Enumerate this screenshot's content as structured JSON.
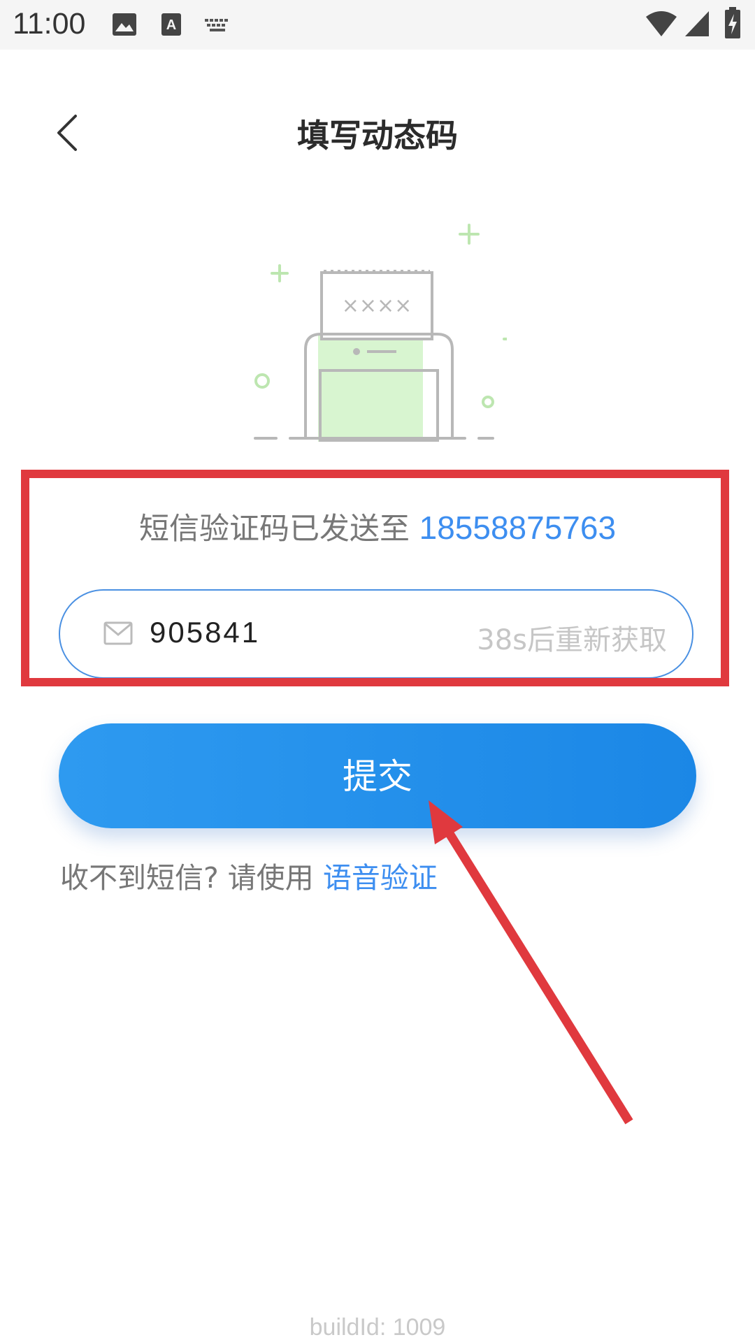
{
  "status_bar": {
    "time": "11:00",
    "icons": [
      "image-icon",
      "text-a-icon",
      "keyboard-icon",
      "wifi-icon",
      "signal-icon",
      "battery-charging-icon"
    ]
  },
  "header": {
    "title": "填写动态码",
    "back_icon": "chevron-left-icon"
  },
  "illustration": {
    "code_placeholder": "××××"
  },
  "verification": {
    "sent_text": "短信验证码已发送至",
    "phone": "18558875763",
    "code_value": "905841",
    "resend_text": "38s后重新获取",
    "field_icon": "mail-icon"
  },
  "submit": {
    "label": "提交"
  },
  "voice": {
    "prompt": "收不到短信? 请使用",
    "link_label": "语音验证"
  },
  "footer": {
    "build_id": "buildId: 1009"
  },
  "colors": {
    "accent": "#3d8ef0",
    "button": "#1b87e6",
    "highlight": "#e0393e",
    "illustration_green": "#d8f5d0"
  }
}
